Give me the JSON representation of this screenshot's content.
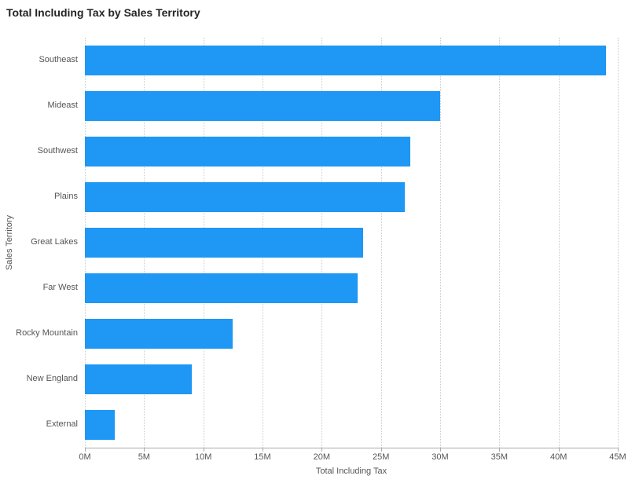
{
  "title": "Total Including Tax by Sales Territory",
  "ylabel": "Sales Territory",
  "xlabel": "Total Including Tax",
  "chart_data": {
    "type": "bar",
    "orientation": "horizontal",
    "categories": [
      "Southeast",
      "Mideast",
      "Southwest",
      "Plains",
      "Great Lakes",
      "Far West",
      "Rocky Mountain",
      "New England",
      "External"
    ],
    "values": [
      44000000,
      30000000,
      27500000,
      27000000,
      23500000,
      23000000,
      12500000,
      9000000,
      2500000
    ],
    "title": "Total Including Tax by Sales Territory",
    "xlabel": "Total Including Tax",
    "ylabel": "Sales Territory",
    "xlim": [
      0,
      45000000
    ],
    "grid": true,
    "bar_color": "#1f97f4"
  },
  "xticks": {
    "values": [
      0,
      5000000,
      10000000,
      15000000,
      20000000,
      25000000,
      30000000,
      35000000,
      40000000,
      45000000
    ],
    "labels": [
      "0M",
      "5M",
      "10M",
      "15M",
      "20M",
      "25M",
      "30M",
      "35M",
      "40M",
      "45M"
    ]
  }
}
